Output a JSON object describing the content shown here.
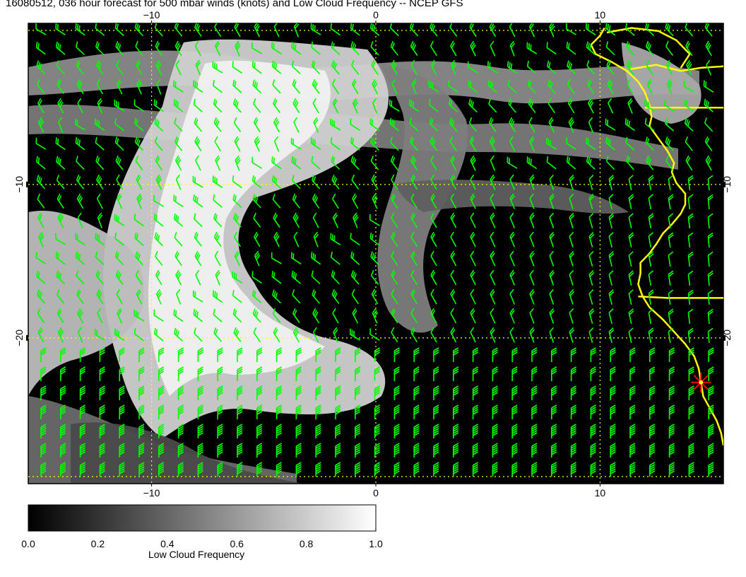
{
  "title": "16080512, 036 hour forecast for 500 mbar winds (knots) and Low Cloud Frequency -- NCEP GFS",
  "map": {
    "lon_range": [
      -15.5,
      15.5
    ],
    "lat_range": [
      -29.5,
      0.5
    ],
    "gridline_lons": [
      -10,
      0,
      10
    ],
    "gridline_lats": [
      -10,
      -20
    ],
    "top_tick_labels": [
      "−10",
      "0",
      "10"
    ],
    "bottom_tick_labels": [
      "−10",
      "0",
      "10"
    ],
    "left_tick_labels": [
      "−10",
      "−20"
    ],
    "right_tick_labels": [
      "−10",
      "−20"
    ],
    "coastline_color": "#ffff00",
    "barb_color": "#00ff00",
    "gridline_color": "#ffff00",
    "marker_color": "#ff0000",
    "marker_lat": -22.9,
    "marker_lon": 14.5
  },
  "colorbar": {
    "title": "Low Cloud Frequency",
    "tick_labels": [
      "0.0",
      "0.2",
      "0.4",
      "0.6",
      "0.8",
      "1.0"
    ],
    "range": [
      0,
      1
    ]
  }
}
